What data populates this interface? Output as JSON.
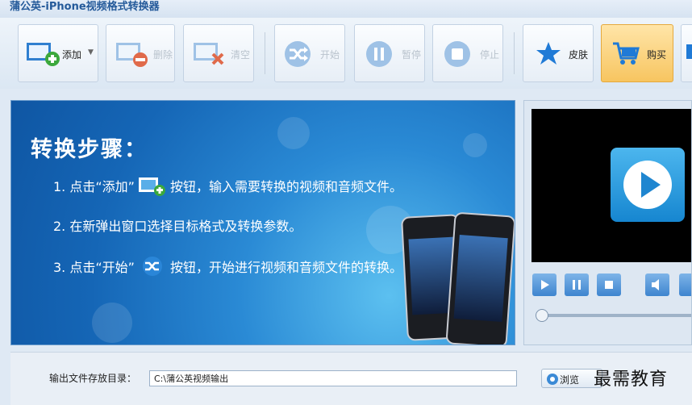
{
  "window": {
    "title": "蒲公英-iPhone视频格式转换器"
  },
  "toolbar": {
    "add_label": "添加",
    "delete_label": "删除",
    "clear_label": "清空",
    "start_label": "开始",
    "pause_label": "暂停",
    "stop_label": "停止",
    "skin_label": "皮肤",
    "buy_label": "购买"
  },
  "guide": {
    "heading": "转换步骤：",
    "step1_a": "1. 点击“添加”",
    "step1_b": "按钮，输入需要转换的视频和音频文件。",
    "step2": "2. 在新弹出窗口选择目标格式及转换参数。",
    "step3_a": "3. 点击“开始”",
    "step3_b": "按钮，开始进行视频和音频文件的转换。"
  },
  "output": {
    "label": "输出文件存放目录：",
    "path": "C:\\蒲公英视频输出",
    "browse_label": "浏览"
  },
  "watermark": "最需教育",
  "colors": {
    "accent": "#1a78d0",
    "buy": "#f7c560"
  }
}
